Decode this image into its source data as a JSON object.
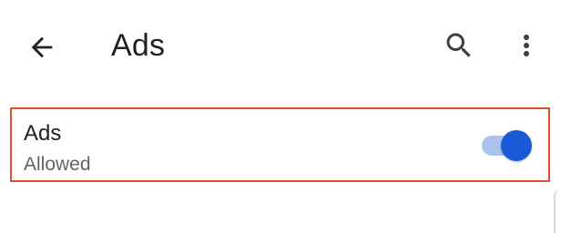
{
  "header": {
    "title": "Ads",
    "back_icon": "arrow-back-icon",
    "search_icon": "search-icon",
    "more_icon": "more-vert-icon"
  },
  "setting": {
    "title": "Ads",
    "summary": "Allowed",
    "toggle_on": true
  },
  "colors": {
    "highlight_border": "#e0502d",
    "toggle_thumb": "#1a5ad6",
    "toggle_track": "#a8c3ee",
    "title_text": "#202124",
    "summary_text": "#5f6368"
  }
}
